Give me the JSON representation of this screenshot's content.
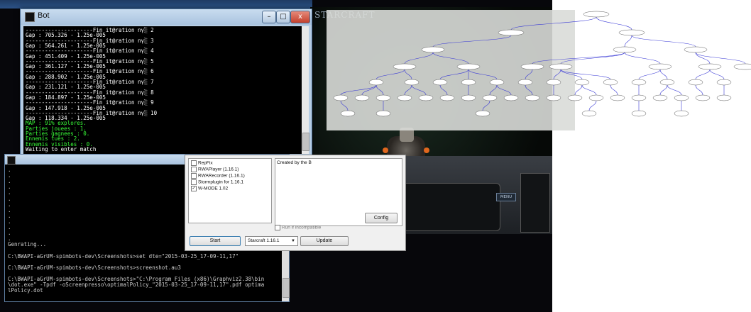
{
  "bot_window": {
    "title": "Bot",
    "buttons": {
      "minimize": "–",
      "maximize": "□",
      "close": "x"
    },
    "lines": [
      {
        "text": "---------------------Fin it@ration nγ░ 2",
        "color": "#ffffff"
      },
      {
        "text": "Gap : 705.326 - 1.25e-005",
        "color": "#ffffff"
      },
      {
        "text": "---------------------Fin it@ration nγ░ 3",
        "color": "#ffffff"
      },
      {
        "text": "Gap : 564.261 - 1.25e-005",
        "color": "#ffffff"
      },
      {
        "text": "---------------------Fin it@ration nγ░ 4",
        "color": "#ffffff"
      },
      {
        "text": "Gap : 451.409 - 1.25e-005",
        "color": "#ffffff"
      },
      {
        "text": "---------------------Fin it@ration nγ░ 5",
        "color": "#ffffff"
      },
      {
        "text": "Gap : 361.127 - 1.25e-005",
        "color": "#ffffff"
      },
      {
        "text": "---------------------Fin it@ration nγ░ 6",
        "color": "#ffffff"
      },
      {
        "text": "Gap : 288.902 - 1.25e-005",
        "color": "#ffffff"
      },
      {
        "text": "---------------------Fin it@ration nγ░ 7",
        "color": "#ffffff"
      },
      {
        "text": "Gap : 231.121 - 1.25e-005",
        "color": "#ffffff"
      },
      {
        "text": "---------------------Fin it@ration nγ░ 8",
        "color": "#ffffff"
      },
      {
        "text": "Gap : 184.897 - 1.25e-005",
        "color": "#ffffff"
      },
      {
        "text": "---------------------Fin it@ration nγ░ 9",
        "color": "#ffffff"
      },
      {
        "text": "Gap : 147.918 - 1.25e-005",
        "color": "#ffffff"
      },
      {
        "text": "---------------------Fin it@ration nγ░ 10",
        "color": "#ffffff"
      },
      {
        "text": "Gap : 118.334 - 1.25e-005",
        "color": "#ffffff"
      },
      {
        "text": "MAP : 91% explores.",
        "color": "#39ff39"
      },
      {
        "text": "Parties jouees : 1.",
        "color": "#39ff39"
      },
      {
        "text": "Parties gagnees : 0.",
        "color": "#39ff39"
      },
      {
        "text": "Ennemis tues : 2.",
        "color": "#39ff39"
      },
      {
        "text": "Ennemis visibles : 0.",
        "color": "#39ff39"
      },
      {
        "text": "Waiting to enter match",
        "color": "#ffffff"
      }
    ]
  },
  "console2": {
    "lines": [
      ".",
      ".",
      ".",
      ".",
      ".",
      ".",
      ".",
      ".",
      ".",
      ".",
      ".",
      ".",
      ".",
      "Genrating...",
      "",
      "C:\\BWAPI-aGrUM-spimbots-dev\\Screenshots>set dte=\"2015-03-25_17-09-11,17\"",
      "",
      "C:\\BWAPI-aGrUM-spimbots-dev\\Screenshots>screenshot.au3",
      "",
      "C:\\BWAPI-aGrUM-spimbots-dev\\Screenshots>\"C:\\Program Files (x86)\\Graphviz2.38\\bin",
      "\\dot.exe\" -Tpdf -oScreenpresso\\optimalPolicy_\"2015-03-25_17-09-11,17\".pdf optima",
      "lPolicy.dot"
    ]
  },
  "launcher": {
    "plugins": [
      {
        "label": "RepFix",
        "checked": false
      },
      {
        "label": "RWAPlayer (1.16.1)",
        "checked": false
      },
      {
        "label": "RWARecorder (1.16.1)",
        "checked": false
      },
      {
        "label": "Stormplugin for 1.16.1",
        "checked": false
      },
      {
        "label": "W-MODE 1.02",
        "checked": true
      }
    ],
    "description": "Created by the B",
    "config_label": "Config",
    "run_incompatible_label": "Run if incompatible",
    "start_label": "Start",
    "version_select": "Starcraft 1.16.1",
    "update_label": "Update"
  },
  "starcraft": {
    "logo": "STARCRAFT",
    "menu_label": "MENU"
  },
  "colors": {
    "console_bg": "#000000",
    "green_text": "#39ff39",
    "graph_edge": "#3a3ad6",
    "window_frame": "#b6cde4"
  }
}
